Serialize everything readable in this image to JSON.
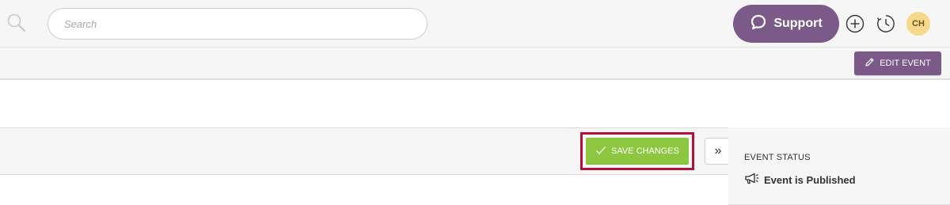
{
  "topbar": {
    "search": {
      "placeholder": "Search",
      "value": ""
    },
    "support_label": "Support",
    "avatar_initials": "CH"
  },
  "event_toolbar": {
    "edit_label": "EDIT EVENT"
  },
  "action_bar": {
    "save_label": "SAVE CHANGES",
    "collapse_glyph": "»"
  },
  "status_panel": {
    "heading": "EVENT STATUS",
    "status_text": "Event is Published"
  },
  "colors": {
    "brand_purple": "#7b5a89",
    "save_green": "#8dc63f",
    "highlight_red": "#b3133b",
    "avatar_yellow": "#f7d98b"
  },
  "icons": [
    "search-icon",
    "speech-bubble-icon",
    "plus-circle-icon",
    "history-clock-icon",
    "pencil-icon",
    "checkmark-icon",
    "double-chevron-right-icon",
    "megaphone-icon"
  ]
}
